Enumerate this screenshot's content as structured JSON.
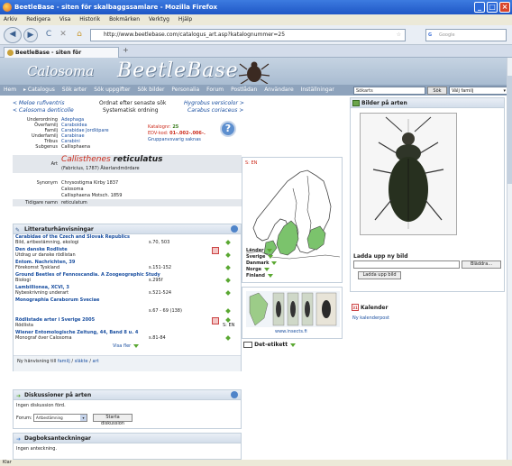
{
  "window": {
    "title": "BeetleBase - siten för skalbaggssamlare - Mozilla Firefox"
  },
  "menu": [
    "Arkiv",
    "Redigera",
    "Visa",
    "Historik",
    "Bokmärken",
    "Verktyg",
    "Hjälp"
  ],
  "nav": {
    "url": "http://www.beetlebase.com/catalogus_art.asp?katalognummer=25",
    "search_placeholder": "Google"
  },
  "tab": {
    "label": "BeetleBase - siten för skalbaggssam..."
  },
  "site": {
    "logo_left": "Calosoma",
    "logo_main": "BeetleBase",
    "nav": [
      "Hem",
      "▸ Catalogus",
      "Sök arter",
      "Sök uppgifter",
      "Sök bilder",
      "Personalia",
      "Forum",
      "Postlådan",
      "Användare",
      "Inställningar"
    ],
    "search_value": "Sökarts",
    "search_button": "Sök",
    "family_select": "Välj familj"
  },
  "species_nav": {
    "prev1": "< Meloe rufiventris",
    "prev2": "< Calosoma denticolle",
    "center1": "Ordnat efter senaste sök",
    "center2": "Systematisk ordning",
    "next1": "Hygrobus versicolor >",
    "next2": "Carabus coriaceus >"
  },
  "taxonomy": {
    "rows": [
      {
        "label": "Underordning",
        "value": "Adephaga"
      },
      {
        "label": "Överfamilj",
        "value": "Caraboidea"
      },
      {
        "label": "Familj",
        "value": "Carabidae  Jordlöpare"
      },
      {
        "label": "Underfamilj",
        "value": "Carabinae"
      },
      {
        "label": "Tribus",
        "value": "Carabini"
      },
      {
        "label": "Subgenus",
        "value": "Callisphaena"
      }
    ],
    "katalog_label": "Katalognr:",
    "katalog_value": "25",
    "edv_label": "EDV-kod:",
    "edv_value": "01-.002-.006-.",
    "group_link": "Gruppanvsvarig saknas"
  },
  "species": {
    "art_label": "Art",
    "name_genus": "Callisthenes",
    "name_epithet": "reticulatus",
    "author": "(Fabricius, 1787) Åkerlandmördare",
    "synonym_label": "Synonym",
    "synonyms": [
      "Chrysostigma  Kirby 1837",
      "Calosoma",
      "Callisphaena  Motsch. 1859"
    ],
    "former_label": "Tidigare namn",
    "former_value": "reticulatum"
  },
  "literature": {
    "title": "Litteraturhänvisningar",
    "items": [
      {
        "title": "Carabidae of the Czech and Slovak Republics",
        "sub": "Bild, artbestämning, ekologi",
        "pages": "s.70, 503"
      },
      {
        "title": "Den danske Rodliste",
        "sub": "Utdrag ur danske rödlistan",
        "pages": ""
      },
      {
        "title": "Entom. Nachrichten, 39",
        "sub": "Förekomst Tyskland",
        "pages": "s.151-152"
      },
      {
        "title": "Ground Beetles of Fennoscandia. A Zoogeographic Study",
        "sub": "Biologi",
        "pages": "s.295f"
      },
      {
        "title": "Lambillionea, XCVI, 3",
        "sub": "Nybeskrivning underart",
        "pages": "s.521-524"
      },
      {
        "title": "Monographia Caraborum Sveciae",
        "sub": "",
        "pages": "s.67 - 69 (138)"
      },
      {
        "title": "Rödlistade arter i Sverige 2005",
        "sub": "Rödlista",
        "pages": "S: EN"
      },
      {
        "title": "Wiener Entomologische Zeitung, 44, Band 8 u. 4",
        "sub": "Monograf över Calosoma",
        "pages": "s.81-84"
      }
    ],
    "show_more": "Visa fler",
    "footer_prefix": "Ny hänvisning till",
    "footer_links": [
      "familj",
      "släkte",
      "art"
    ]
  },
  "discussions": {
    "title": "Diskussioner på arten",
    "empty": "Ingen diskussion förd.",
    "forum_label": "Forum:",
    "forum_value": "Artbestämning",
    "start_button": "Starta diskussion"
  },
  "diary": {
    "title": "Dagboksanteckningar",
    "empty": "Ingen anteckning."
  },
  "distribution": {
    "map_label": "S: EN",
    "countries": [
      "Länder",
      "Sverige",
      "Danmark",
      "Norge",
      "Finland"
    ],
    "insect_link": "www.insects.fi",
    "det_label": "Det-etikett"
  },
  "images": {
    "title": "Bilder på arten",
    "upload_label": "Ladda upp ny bild",
    "browse_button": "Bläddra...",
    "upload_button": "Ladda upp bild"
  },
  "calendar": {
    "title": "Kalender",
    "new_link": "Ny kalenderpost"
  },
  "status": {
    "text": "Klar"
  },
  "colors": {
    "accent": "#cc2a1a",
    "link": "#1a4fa0",
    "header": "#8ea3bc"
  }
}
